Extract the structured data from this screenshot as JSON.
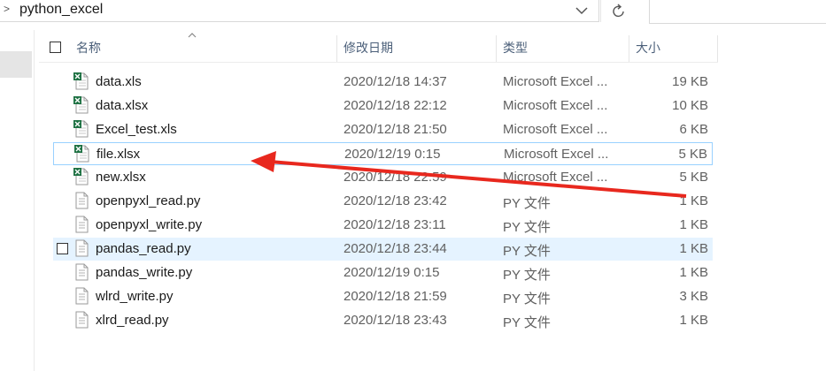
{
  "address": {
    "path": "python_excel"
  },
  "columns": {
    "name": "名称",
    "date": "修改日期",
    "type": "类型",
    "size": "大小"
  },
  "files": [
    {
      "name": "data.xls",
      "date": "2020/12/18 14:37",
      "type": "Microsoft Excel ...",
      "size": "19 KB",
      "icon": "excel-file-icon"
    },
    {
      "name": "data.xlsx",
      "date": "2020/12/18 22:12",
      "type": "Microsoft Excel ...",
      "size": "10 KB",
      "icon": "excel-file-icon"
    },
    {
      "name": "Excel_test.xls",
      "date": "2020/12/18 21:50",
      "type": "Microsoft Excel ...",
      "size": "6 KB",
      "icon": "excel-file-icon"
    },
    {
      "name": "file.xlsx",
      "date": "2020/12/19 0:15",
      "type": "Microsoft Excel ...",
      "size": "5 KB",
      "icon": "excel-file-icon",
      "selected": true
    },
    {
      "name": "new.xlsx",
      "date": "2020/12/18 22:59",
      "type": "Microsoft Excel ...",
      "size": "5 KB",
      "icon": "excel-file-icon"
    },
    {
      "name": "openpyxl_read.py",
      "date": "2020/12/18 23:42",
      "type": "PY 文件",
      "size": "1 KB",
      "icon": "py-file-icon"
    },
    {
      "name": "openpyxl_write.py",
      "date": "2020/12/18 23:11",
      "type": "PY 文件",
      "size": "1 KB",
      "icon": "py-file-icon"
    },
    {
      "name": "pandas_read.py",
      "date": "2020/12/18 23:44",
      "type": "PY 文件",
      "size": "1 KB",
      "icon": "py-file-icon",
      "hover": true
    },
    {
      "name": "pandas_write.py",
      "date": "2020/12/19 0:15",
      "type": "PY 文件",
      "size": "1 KB",
      "icon": "py-file-icon"
    },
    {
      "name": "wlrd_write.py",
      "date": "2020/12/18 21:59",
      "type": "PY 文件",
      "size": "3 KB",
      "icon": "py-file-icon"
    },
    {
      "name": "xlrd_read.py",
      "date": "2020/12/18 23:43",
      "type": "PY 文件",
      "size": "1 KB",
      "icon": "py-file-icon"
    }
  ],
  "colors": {
    "selection_border": "#99d1ff",
    "hover_bg": "#e5f3ff",
    "annotation_arrow": "#e8281e",
    "header_text": "#4c607a"
  }
}
